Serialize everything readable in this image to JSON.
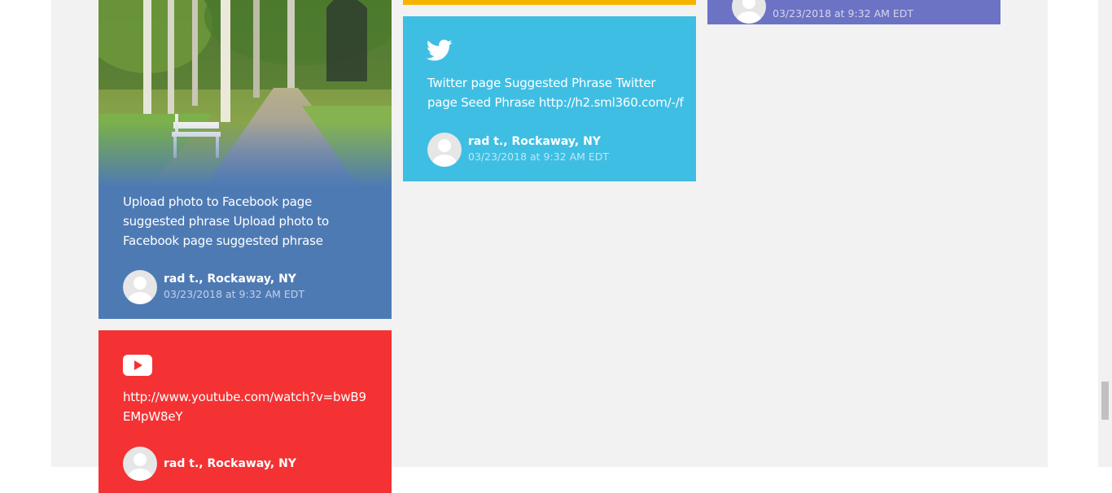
{
  "cards": {
    "photo_card": {
      "text": "Upload photo to Facebook page suggested phrase Upload photo to Facebook page suggested phrase",
      "author_name": "rad t., Rockaway, NY",
      "author_date": "03/23/2018 at 9:32 AM EDT",
      "color": "#4e7ab4"
    },
    "youtube_card": {
      "icon": "youtube-icon",
      "text": "http://www.youtube.com/watch?v=bwB9EMpW8eY",
      "author_name": "rad t., Rockaway, NY",
      "color": "#f43234"
    },
    "twitter_card": {
      "icon": "twitter-icon",
      "text": "Twitter page Suggested Phrase Twitter page Seed Phrase http://h2.sml360.com/-/f",
      "author_name": "rad t., Rockaway, NY",
      "author_date": "03/23/2018 at 9:32 AM EDT",
      "color": "#3fbee3"
    },
    "purple_card": {
      "author_date": "03/23/2018 at 9:32 AM EDT",
      "color": "#6c73c4"
    },
    "yellow_card": {
      "color": "#f5b300"
    }
  },
  "page": {
    "background": "#f2f2f2"
  }
}
